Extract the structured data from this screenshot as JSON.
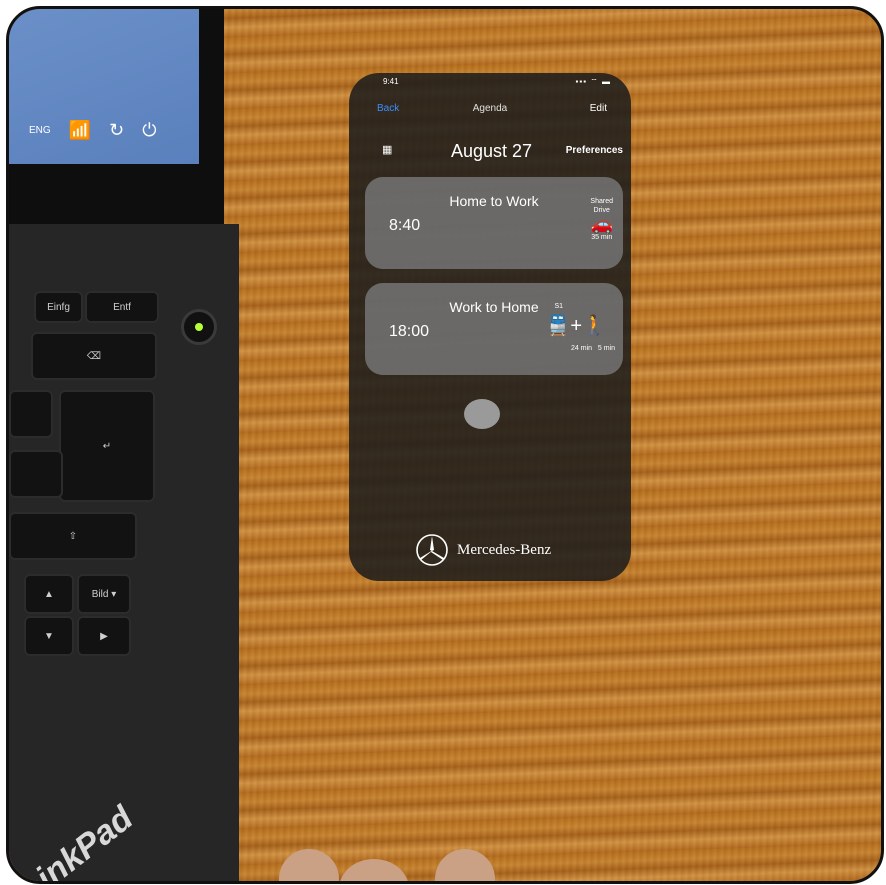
{
  "laptop": {
    "tray_lang": "ENG",
    "keys": {
      "einfg": "Einfg",
      "entf": "Entf",
      "bild": "Bild ▾"
    },
    "brand": "inkPad"
  },
  "phone": {
    "status_time": "9:41",
    "status_icons": "▪▪▪ ⌔ ▬",
    "nav": {
      "back": "Back",
      "title": "Agenda",
      "edit": "Edit"
    },
    "grid_icon": "grid-icon",
    "date": "August 27",
    "preferences": "Preferences",
    "trips": [
      {
        "title": "Home to Work",
        "time": "8:40",
        "mode_label": "Shared\nDrive",
        "icon": "car-icon",
        "duration": "35 min"
      },
      {
        "title": "Work to Home",
        "time": "18:00",
        "line": "S1",
        "icon": "train-walk-icon",
        "duration_transit": "24 min",
        "duration_walk": "5 min"
      }
    ],
    "brand": "Mercedes-Benz"
  }
}
